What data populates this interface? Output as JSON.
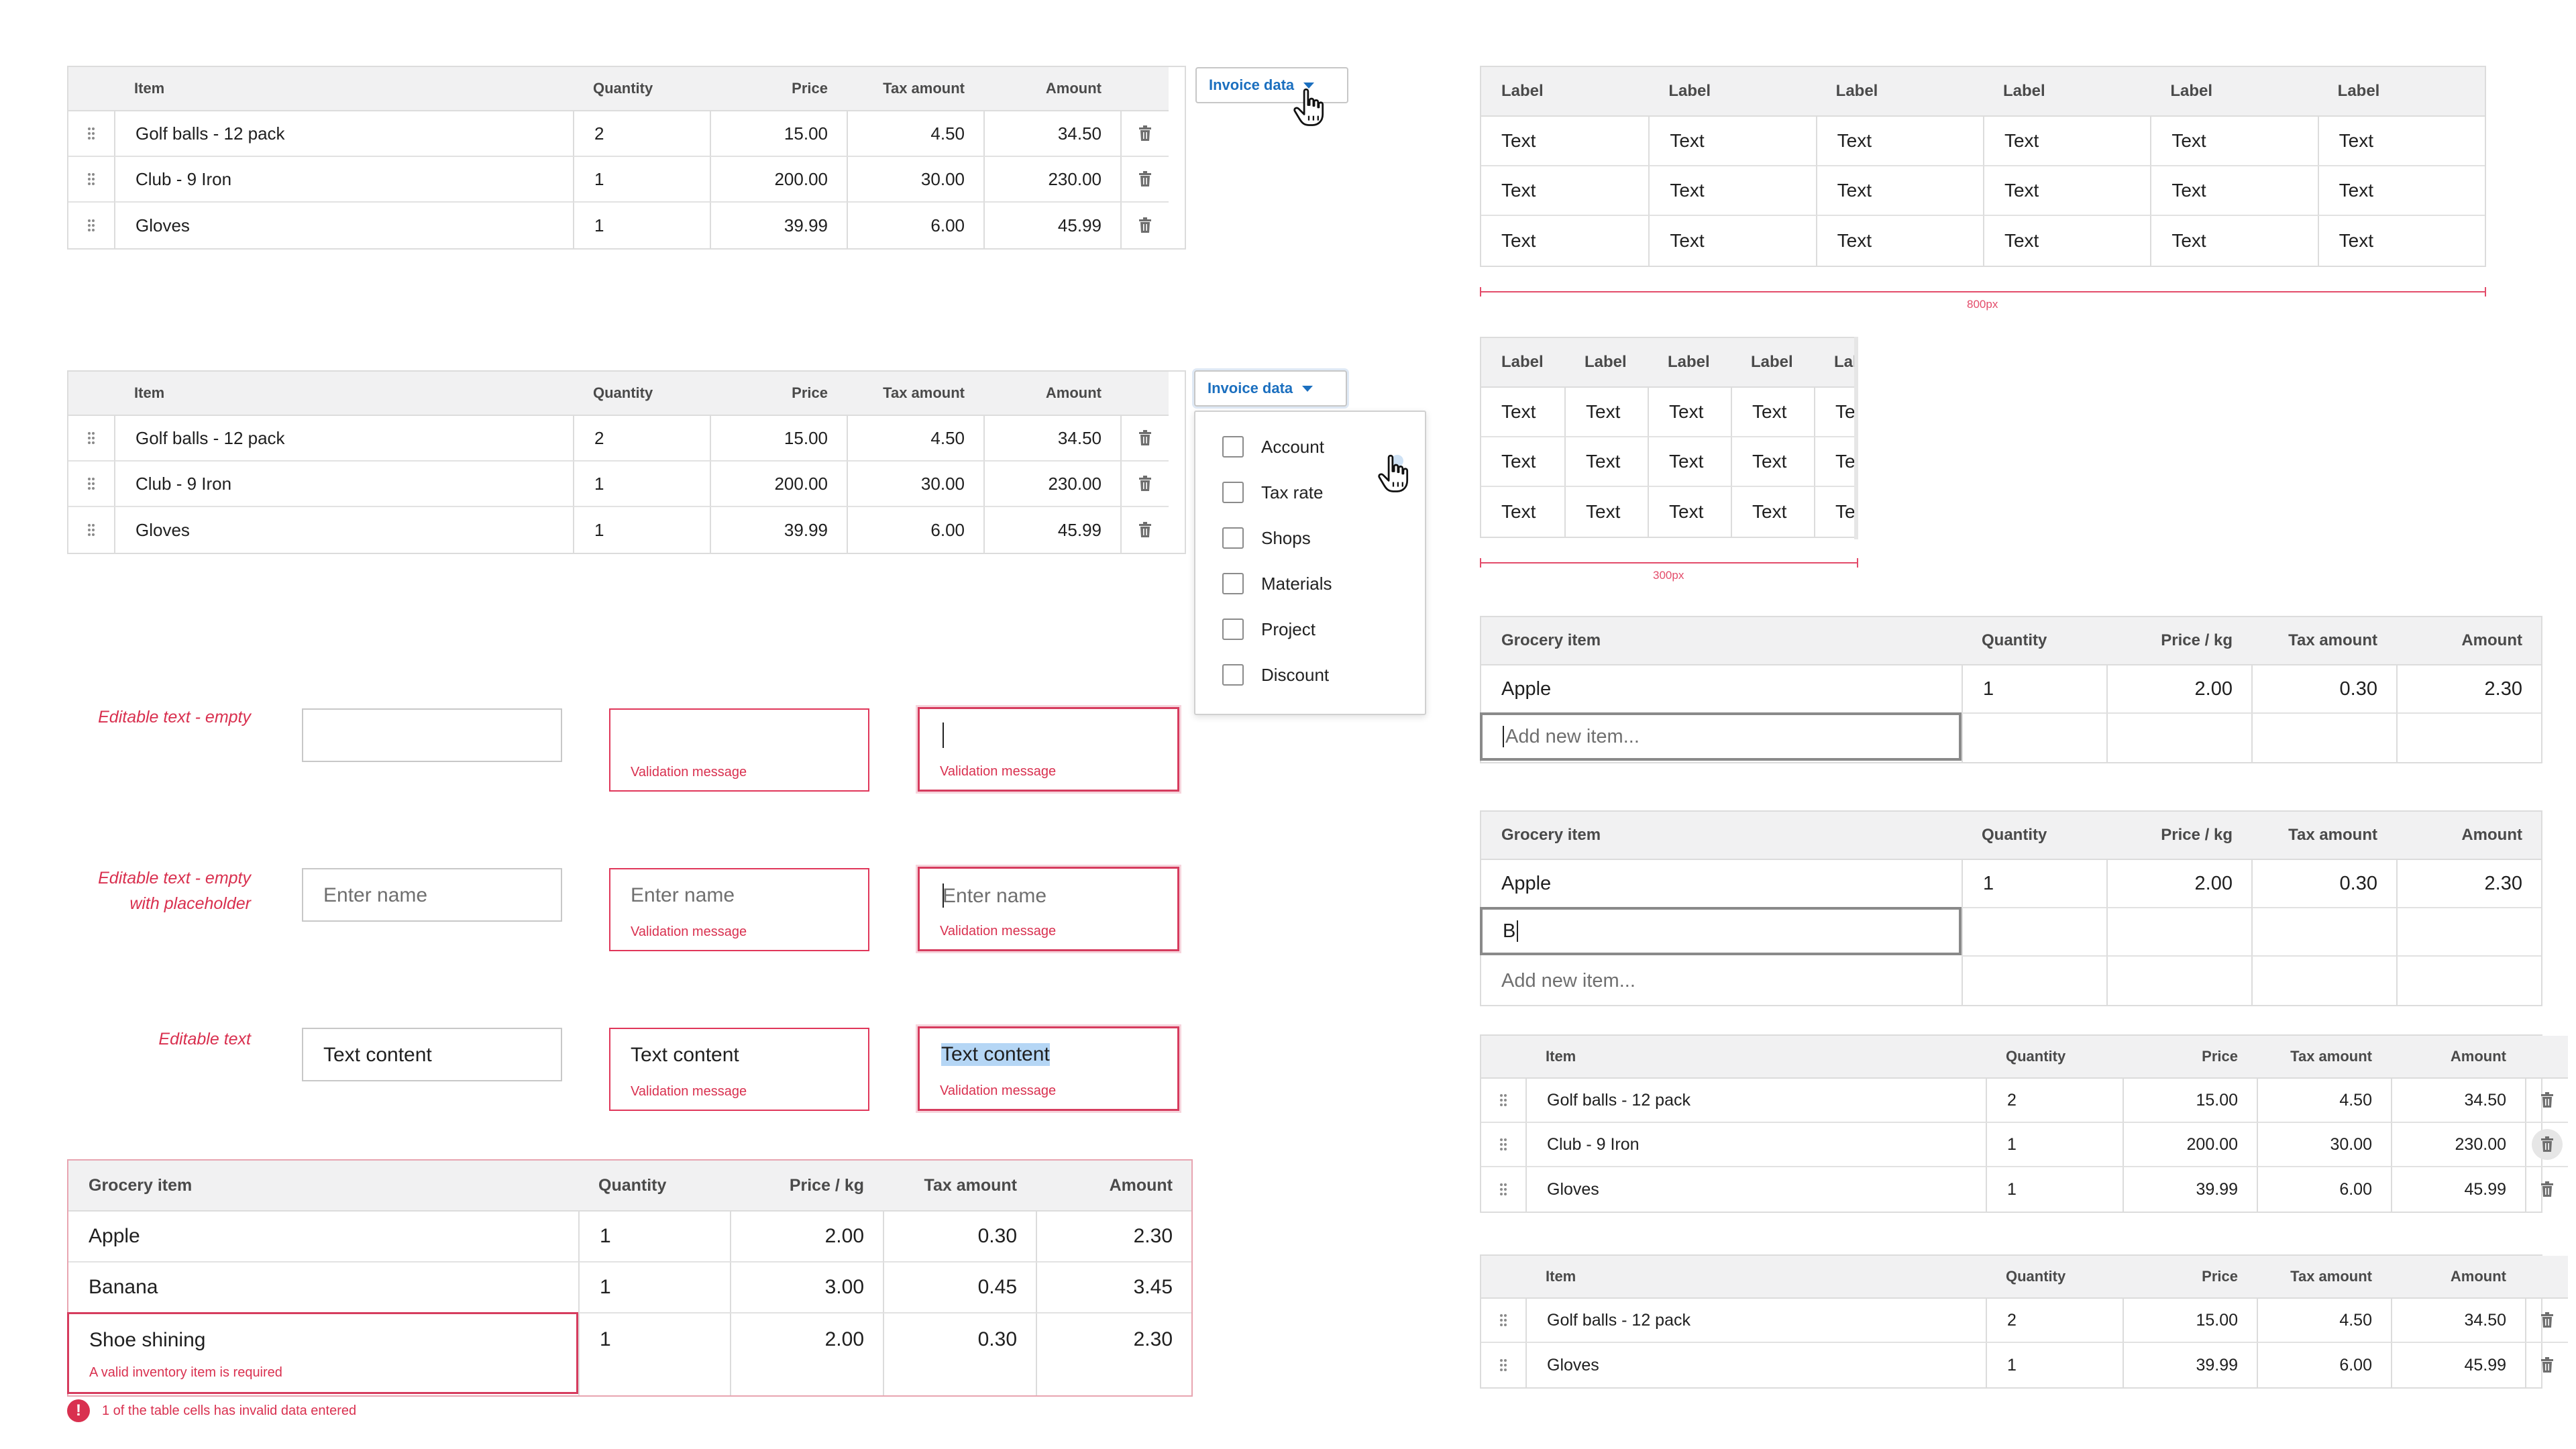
{
  "invoice": {
    "headers": [
      "Item",
      "Quantity",
      "Price",
      "Tax amount",
      "Amount"
    ],
    "rows": [
      [
        "Golf balls - 12 pack",
        "2",
        "15.00",
        "4.50",
        "34.50"
      ],
      [
        "Club - 9 Iron",
        "1",
        "200.00",
        "30.00",
        "230.00"
      ],
      [
        "Gloves",
        "1",
        "39.99",
        "6.00",
        "45.99"
      ]
    ],
    "rows_deleted": [
      [
        "Golf balls - 12 pack",
        "2",
        "15.00",
        "4.50",
        "34.50"
      ],
      [
        "Gloves",
        "1",
        "39.99",
        "6.00",
        "45.99"
      ]
    ]
  },
  "dropdown": {
    "label": "Invoice data",
    "options": [
      "Account",
      "Tax rate",
      "Shops",
      "Materials",
      "Project",
      "Discount"
    ]
  },
  "labeltable": {
    "header": "Label",
    "cell": "Text",
    "caption_wide": "800px",
    "caption_narrow": "300px"
  },
  "editable": {
    "label_empty": "Editable text - empty",
    "label_placeholder_1": "Editable text - empty",
    "label_placeholder_2": "with placeholder",
    "label_text": "Editable text",
    "placeholder": "Enter name",
    "content": "Text content",
    "validation": "Validation message"
  },
  "grocery": {
    "headers": [
      "Grocery item",
      "Quantity",
      "Price / kg",
      "Tax amount",
      "Amount"
    ],
    "apple": [
      "Apple",
      "1",
      "2.00",
      "0.30",
      "2.30"
    ],
    "banana": [
      "Banana",
      "1",
      "3.00",
      "0.45",
      "3.45"
    ],
    "shoe": [
      "Shoe shining",
      "1",
      "2.00",
      "0.30",
      "2.30"
    ],
    "add_placeholder": "Add new item...",
    "typed": "B",
    "shoe_error": "A valid inventory item is required",
    "table_error": "1 of the table cells has invalid data entered",
    "error_icon": "!"
  },
  "colors": {
    "accent": "#1b6fbf",
    "error": "#d9304f",
    "header_bg": "#f1f1f2"
  }
}
